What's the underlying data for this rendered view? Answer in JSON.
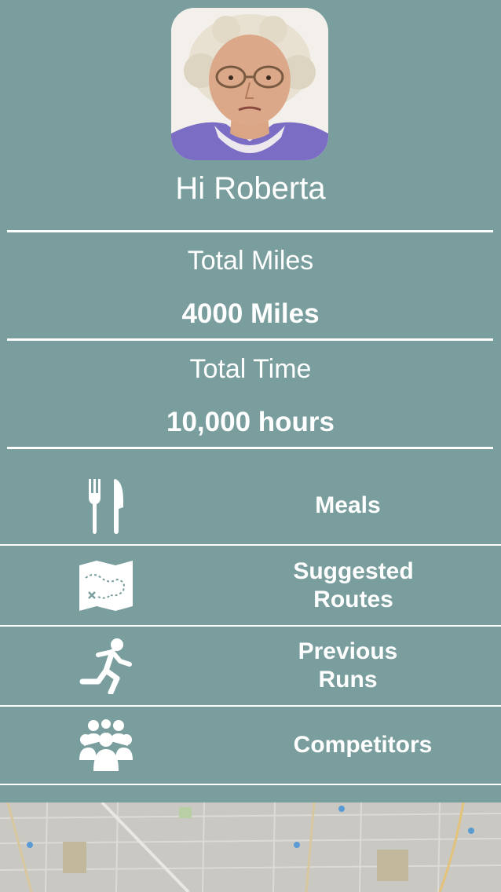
{
  "profile": {
    "greeting": "Hi Roberta"
  },
  "stats": {
    "miles_label": "Total Miles",
    "miles_value": "4000 Miles",
    "time_label": "Total Time",
    "time_value": "10,000 hours"
  },
  "menu": {
    "items": [
      {
        "label": "Meals",
        "icon": "fork-knife-icon"
      },
      {
        "label_line1": "Suggested",
        "label_line2": "Routes",
        "icon": "treasure-map-icon"
      },
      {
        "label_line1": "Previous",
        "label_line2": "Runs",
        "icon": "runner-icon"
      },
      {
        "label": "Competitors",
        "icon": "group-icon"
      }
    ]
  },
  "colors": {
    "background": "#799e9d",
    "foreground": "#ffffff"
  }
}
